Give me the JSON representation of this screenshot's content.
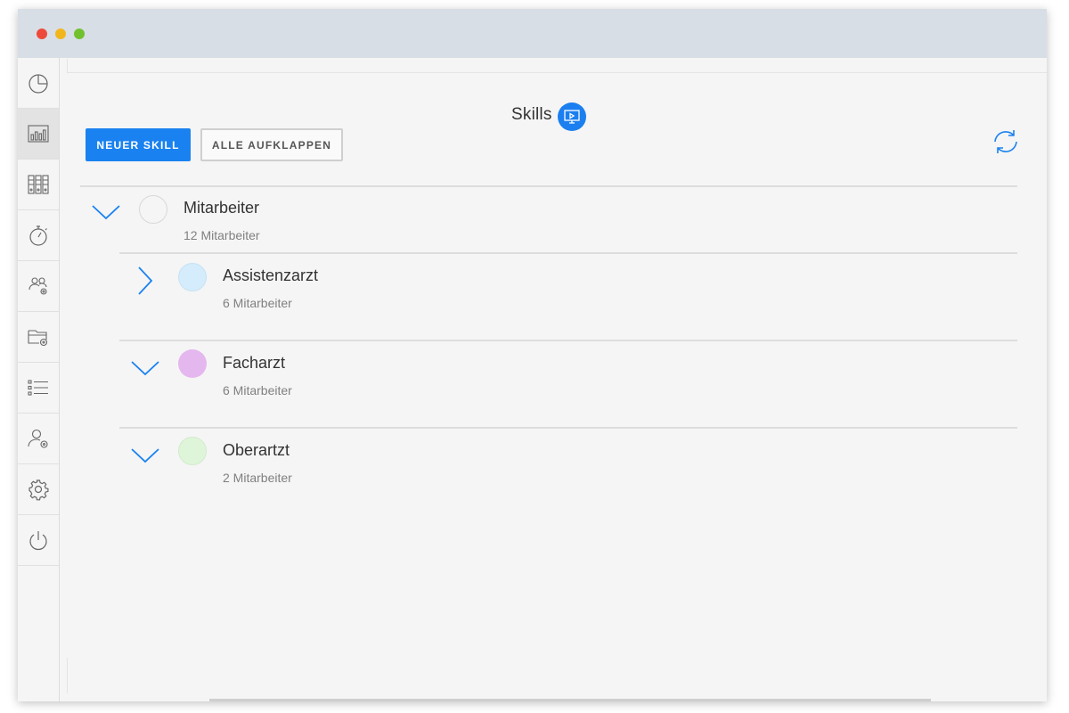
{
  "window": {
    "traffic_lights": [
      "close",
      "minimize",
      "zoom"
    ]
  },
  "sidebar": {
    "items": [
      {
        "icon": "pie-chart-icon",
        "active": false
      },
      {
        "icon": "bar-chart-icon",
        "active": true
      },
      {
        "icon": "binders-icon",
        "active": false
      },
      {
        "icon": "stopwatch-icon",
        "active": false
      },
      {
        "icon": "group-settings-icon",
        "active": false
      },
      {
        "icon": "folder-settings-icon",
        "active": false
      },
      {
        "icon": "list-icon",
        "active": false
      },
      {
        "icon": "user-settings-icon",
        "active": false
      },
      {
        "icon": "gear-icon",
        "active": false
      },
      {
        "icon": "power-icon",
        "active": false
      }
    ]
  },
  "header": {
    "title": "Skills",
    "title_icon": "presentation-screen-icon"
  },
  "toolbar": {
    "new_skill_label": "NEUER SKILL",
    "expand_all_label": "ALLE AUFKLAPPEN",
    "refresh_icon": "refresh-icon"
  },
  "tree": {
    "root": {
      "name": "Mitarbeiter",
      "count": "12 Mitarbeiter",
      "color": "#f5f5f5",
      "expanded": true
    },
    "children": [
      {
        "name": "Assistenzarzt",
        "count": "6 Mitarbeiter",
        "color": "#d4ecfb",
        "expanded": false
      },
      {
        "name": "Facharzt",
        "count": "6 Mitarbeiter",
        "color": "#e4b7ef",
        "expanded": true
      },
      {
        "name": "Oberartzt",
        "count": "2 Mitarbeiter",
        "color": "#dff5da",
        "expanded": true
      }
    ]
  },
  "colors": {
    "accent": "#1a82f0",
    "titlebar": "#d8dee5",
    "background": "#f5f5f5"
  }
}
